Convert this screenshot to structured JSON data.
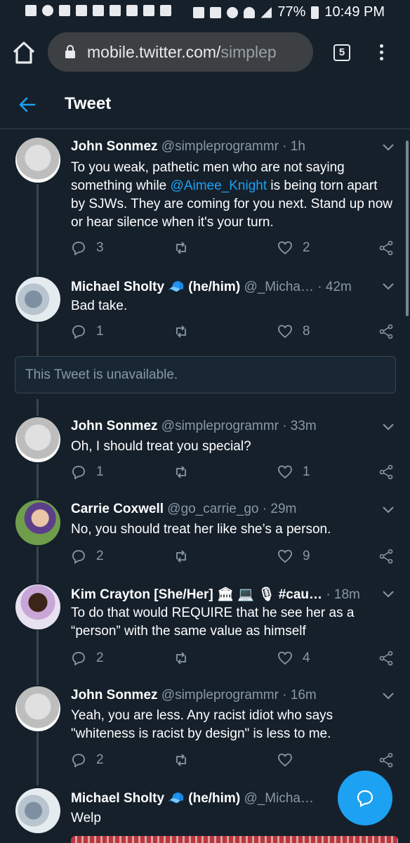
{
  "status_bar": {
    "battery": "77%",
    "time": "10:49 PM"
  },
  "browser": {
    "url_host": "mobile.twitter.com/",
    "url_path": "simplep",
    "tab_count": "5"
  },
  "header": {
    "title": "Tweet"
  },
  "unavailable_notice": "This Tweet is unavailable.",
  "tweets": [
    {
      "name": "John Sonmez",
      "handle": "@simpleprogrammr",
      "time": "1h",
      "text_parts": [
        "To you weak, pathetic men who are not saying something while ",
        "@Aimee_Knight",
        " is being torn apart by SJWs. They are coming for you next. Stand up now or hear silence when it's your turn."
      ],
      "replies": "3",
      "retweets": "",
      "likes": "2"
    },
    {
      "name": "Michael Sholty",
      "name_emoji": "🧢",
      "pronouns": "(he/him)",
      "handle": "@_Micha…",
      "time": "42m",
      "text": "Bad take.",
      "replies": "1",
      "retweets": "",
      "likes": "8"
    },
    {
      "name": "John Sonmez",
      "handle": "@simpleprogrammr",
      "time": "33m",
      "text": "Oh, I should treat you special?",
      "replies": "1",
      "retweets": "",
      "likes": "1"
    },
    {
      "name": "Carrie Coxwell",
      "handle": "@go_carrie_go",
      "time": "29m",
      "text": "No, you should treat her like she’s a person.",
      "replies": "2",
      "retweets": "",
      "likes": "9"
    },
    {
      "name": "Kim Crayton [She/Her] 🏛 💻 🎙 #cau…",
      "handle": "",
      "time": "18m",
      "text": "To do that would REQUIRE that he see her as a “person” with the same value as himself",
      "replies": "2",
      "retweets": "",
      "likes": "4"
    },
    {
      "name": "John Sonmez",
      "handle": "@simpleprogrammr",
      "time": "16m",
      "text": "Yeah, you are less. Any racist idiot who says \"whiteness is racist by design\" is less to me.",
      "replies": "2",
      "retweets": "",
      "likes": ""
    },
    {
      "name": "Michael Sholty",
      "name_emoji": "🧢",
      "pronouns": "(he/him)",
      "handle": "@_Micha…",
      "time": "",
      "text": "Welp"
    }
  ],
  "icons": {
    "reply": "speech-bubble-icon",
    "retweet": "retweet-icon",
    "like": "heart-icon",
    "share": "share-icon",
    "caret": "chevron-down-icon",
    "back": "back-arrow-icon",
    "compose": "compose-reply-icon"
  },
  "colors": {
    "background": "#15202b",
    "accent": "#1da1f2",
    "muted": "#8899a6",
    "divider": "#38444d"
  }
}
